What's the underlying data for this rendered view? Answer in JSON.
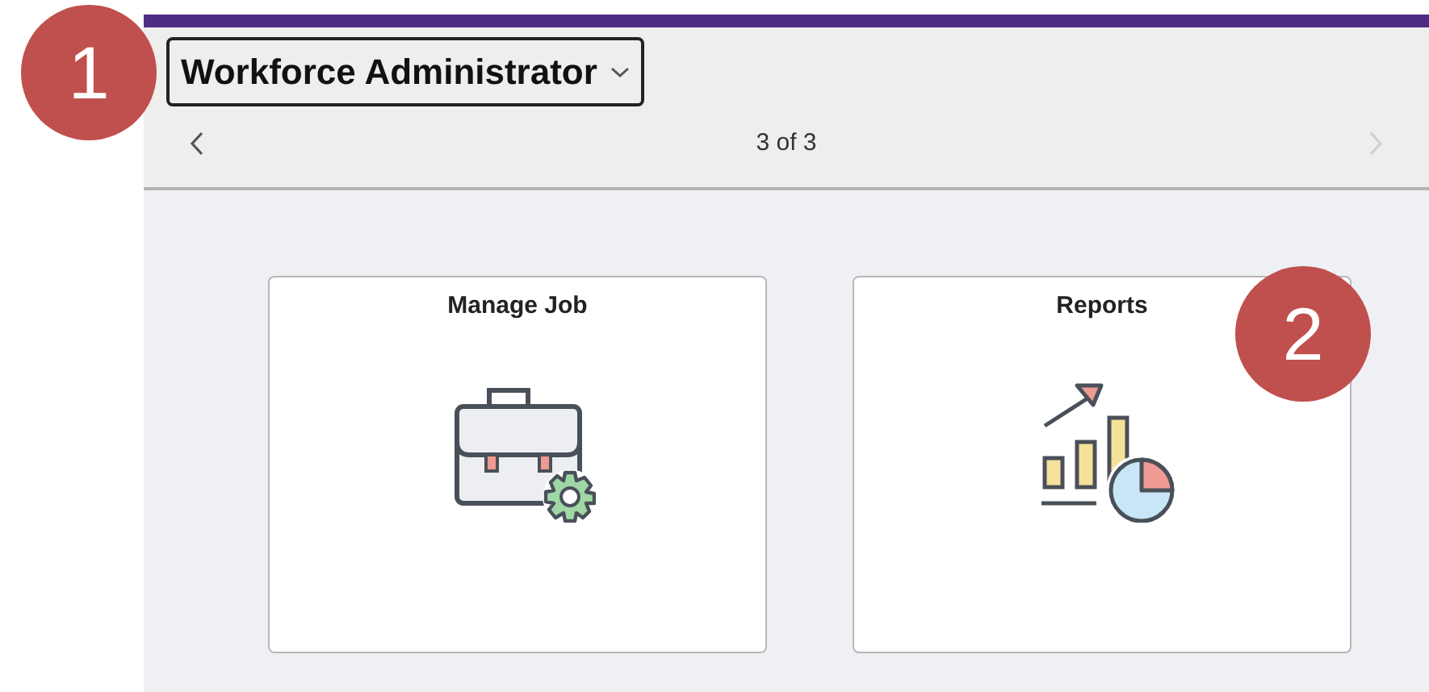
{
  "callouts": [
    {
      "number": "1"
    },
    {
      "number": "2"
    }
  ],
  "header": {
    "title": "Workforce Administrator",
    "expanded": false
  },
  "pager": {
    "text": "3 of 3",
    "previous": {
      "disabled": false
    },
    "next": {
      "disabled": true
    }
  },
  "tiles": [
    {
      "title": "Manage Job",
      "kind": "briefcase"
    },
    {
      "title": "Reports",
      "kind": "reports"
    }
  ]
}
